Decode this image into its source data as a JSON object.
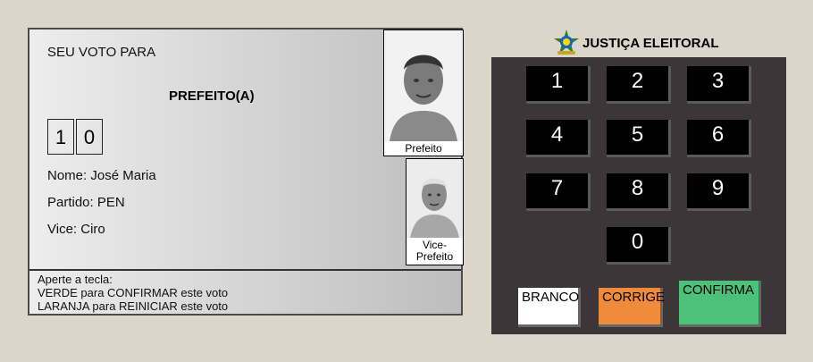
{
  "screen": {
    "vote_for": "SEU VOTO PARA",
    "office": "PREFEITO(A)",
    "digits": [
      "1",
      "0"
    ],
    "name_line": "Nome: José Maria",
    "party_line": "Partido: PEN",
    "vice_line": "Vice: Ciro",
    "photo_main_caption": "Prefeito",
    "photo_vice_caption_1": "Vice-",
    "photo_vice_caption_2": "Prefeito",
    "instructions": [
      "Aperte a tecla:",
      "VERDE para CONFIRMAR este voto",
      "LARANJA para REINICIAR este voto"
    ]
  },
  "keypad": {
    "brand": "JUSTIÇA ELEITORAL",
    "keys": [
      "1",
      "2",
      "3",
      "4",
      "5",
      "6",
      "7",
      "8",
      "9",
      "0"
    ],
    "actions": {
      "white": "BRANCO",
      "corrige": "CORRIGE",
      "confirma": "CONFIRMA"
    },
    "colors": {
      "keypad_bg": "#3d3638",
      "white": "#ffffff",
      "orange": "#f08b3b",
      "green": "#4dc17a"
    }
  }
}
